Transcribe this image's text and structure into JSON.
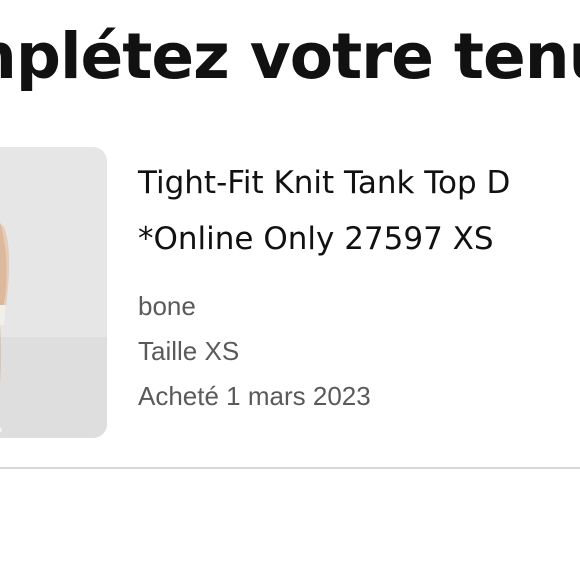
{
  "header": {
    "title": "nplétez votre tenu"
  },
  "product": {
    "name_line1": "Tight-Fit Knit Tank Top D",
    "name_line2": "*Online Only 27597 XS",
    "color": "bone",
    "size": "Taille XS",
    "purchased": "Acheté 1 mars 2023",
    "image_icon": "product-photo"
  },
  "colors": {
    "text_primary": "#111111",
    "text_secondary": "#5a5a5a",
    "divider": "#d7d7d7",
    "image_bg": "#e4e4e4"
  }
}
